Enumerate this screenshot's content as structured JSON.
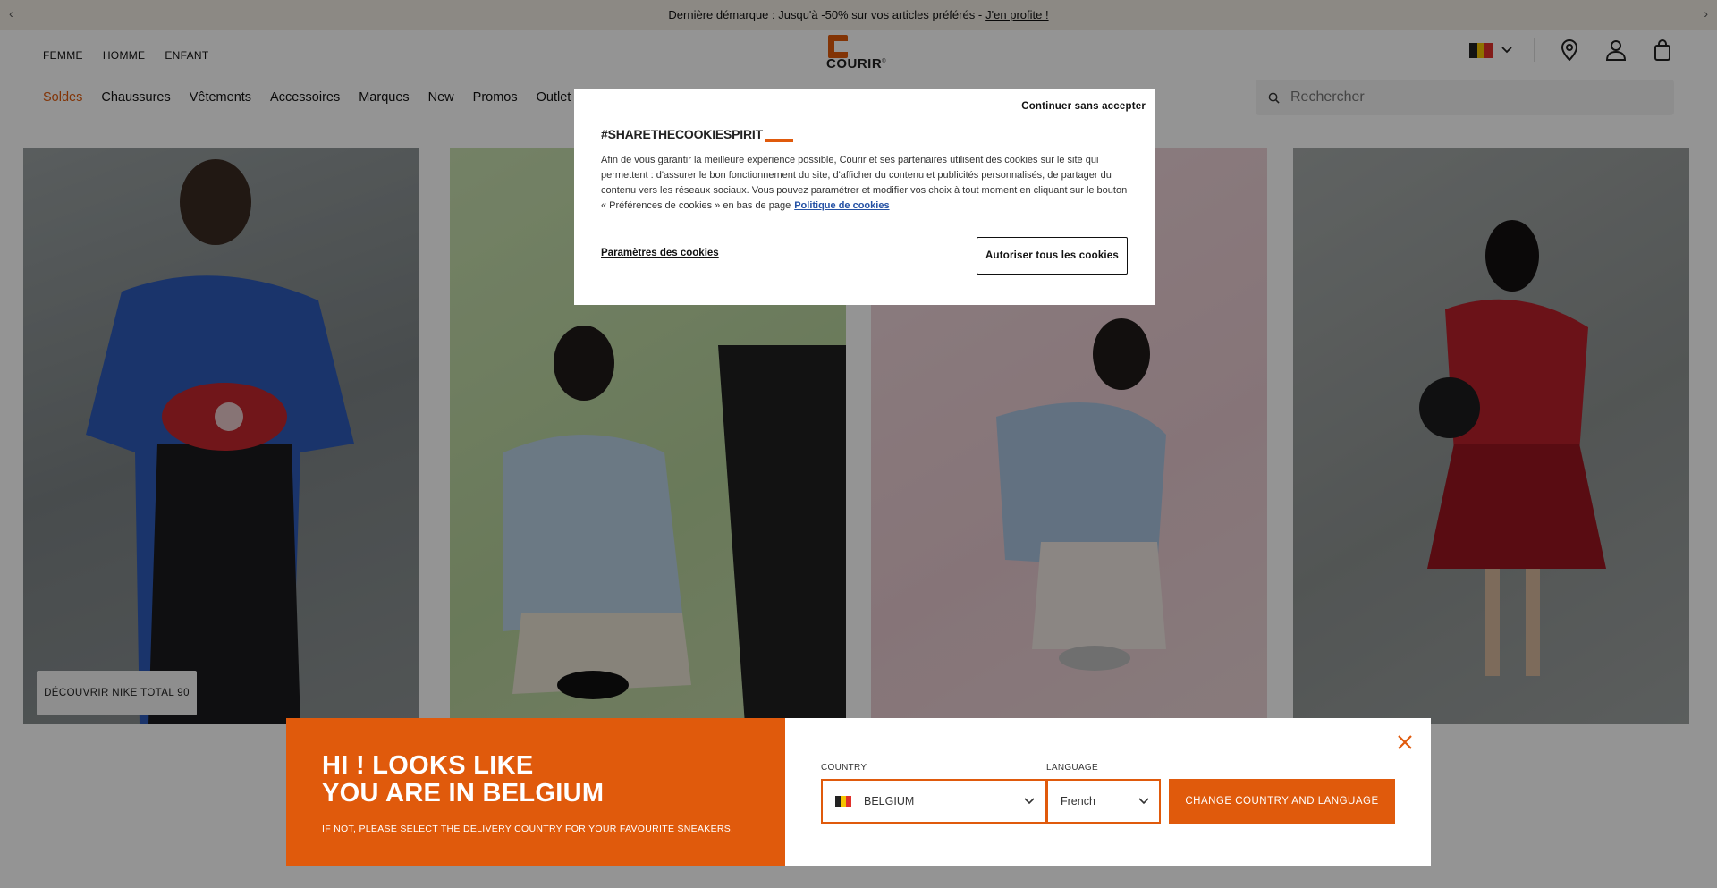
{
  "promo": {
    "text": "Dernière démarque : Jusqu'à -50% sur vos articles préférés -",
    "link": "J'en profite !"
  },
  "header": {
    "gender_nav": [
      "FEMME",
      "HOMME",
      "ENFANT"
    ],
    "logo_text": "COURIR",
    "logo_mark": "®",
    "main_nav": [
      "Soldes",
      "Chaussures",
      "Vêtements",
      "Accessoires",
      "Marques",
      "New",
      "Promos",
      "Outlet"
    ],
    "search_placeholder": "Rechercher",
    "colors": {
      "accent": "#e05a0c"
    }
  },
  "hero": {
    "cta": "DÉCOUVRIR NIKE TOTAL 90"
  },
  "cookie": {
    "skip": "Continuer sans accepter",
    "title": "#SHARETHECOOKIESPIRIT",
    "body": "Afin de vous garantir la meilleure expérience possible, Courir et ses partenaires utilisent des cookies sur le site qui permettent : d'assurer le bon fonctionnement du site, d'afficher du contenu et publicités personnalisés, de partager du contenu vers les réseaux sociaux. Vous pouvez paramétrer et modifier vos choix à tout moment en cliquant sur le bouton « Préférences de cookies » en bas de page",
    "policy_link": "Politique de cookies",
    "settings": "Paramètres des cookies",
    "accept": "Autoriser tous les cookies"
  },
  "country_banner": {
    "title_line1": "HI ! LOOKS LIKE",
    "title_line2": "YOU ARE IN BELGIUM",
    "subtitle": "IF NOT, PLEASE SELECT THE DELIVERY COUNTRY FOR YOUR FAVOURITE SNEAKERS.",
    "country_label": "COUNTRY",
    "country_value": "BELGIUM",
    "language_label": "LANGUAGE",
    "language_value": "French",
    "cta": "CHANGE COUNTRY AND LANGUAGE"
  }
}
